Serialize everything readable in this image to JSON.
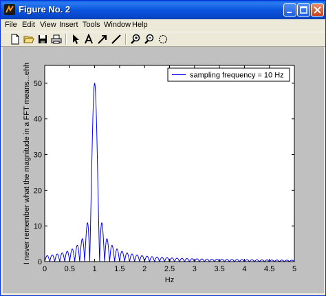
{
  "window": {
    "title": "Figure No. 2",
    "colors": {
      "titlebar": "#0b54de",
      "figure_bg": "#c0c0c0",
      "line": "#0000ff"
    }
  },
  "menu": {
    "items": [
      "File",
      "Edit",
      "View",
      "Insert",
      "Tools",
      "Window",
      "Help"
    ]
  },
  "toolbar": {
    "icons": [
      "new-file-icon",
      "open-folder-icon",
      "save-icon",
      "print-icon",
      "select-arrow-icon",
      "text-icon",
      "arrow-icon",
      "line-icon",
      "zoom-in-icon",
      "zoom-out-icon",
      "rotate-icon"
    ]
  },
  "chart_data": {
    "type": "line",
    "xlabel": "Hz",
    "ylabel": "I never remember what the magnitude in a FFT means...ehh",
    "legend": {
      "label": "sampling frequency = 10 Hz",
      "position": "top-right"
    },
    "xlim": [
      0,
      5
    ],
    "ylim": [
      0,
      55
    ],
    "xticks": [
      0,
      0.5,
      1,
      1.5,
      2,
      2.5,
      3,
      3.5,
      4,
      4.5,
      5
    ],
    "xtick_labels": [
      "0",
      "0.5",
      "1",
      "1.5",
      "2",
      "2.5",
      "3",
      "3.5",
      "4",
      "4.5",
      "5"
    ],
    "yticks": [
      0,
      10,
      20,
      30,
      40,
      50
    ],
    "ytick_labels": [
      "0",
      "10",
      "20",
      "30",
      "40",
      "50"
    ],
    "grid": false,
    "series": [
      {
        "name": "sampling frequency = 10 Hz",
        "color": "#0000ff",
        "model": {
          "peak_frequency": 1.0,
          "peak_value": 50,
          "sinc_width": 0.1
        },
        "sample_points": [
          {
            "x": 0.0,
            "y": 2.0
          },
          {
            "x": 0.6,
            "y": 4.5
          },
          {
            "x": 0.8,
            "y": 7.0
          },
          {
            "x": 0.9,
            "y": 11.5
          },
          {
            "x": 1.0,
            "y": 50.0
          },
          {
            "x": 1.15,
            "y": 10.0
          },
          {
            "x": 1.3,
            "y": 5.0
          },
          {
            "x": 2.0,
            "y": 1.8
          },
          {
            "x": 3.0,
            "y": 1.0
          },
          {
            "x": 5.0,
            "y": 0.5
          }
        ]
      }
    ]
  }
}
